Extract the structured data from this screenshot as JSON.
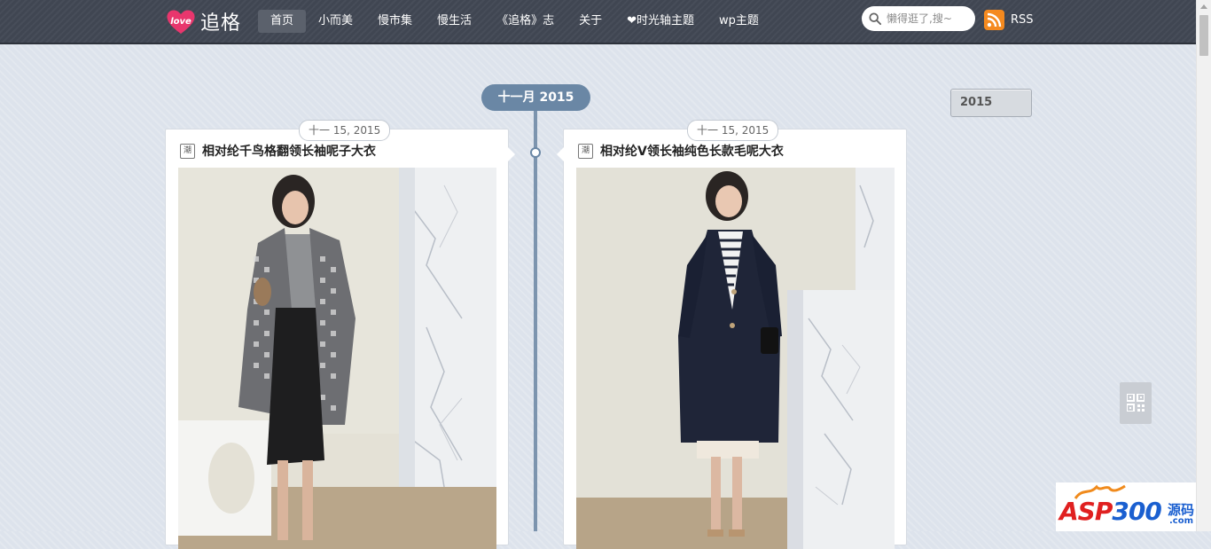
{
  "header": {
    "logo_text": "追格",
    "logo_mark": "love",
    "nav": [
      {
        "label": "首页",
        "active": true
      },
      {
        "label": "小而美",
        "active": false
      },
      {
        "label": "慢市集",
        "active": false
      },
      {
        "label": "慢生活",
        "active": false
      },
      {
        "label": "《追格》志",
        "active": false
      },
      {
        "label": "关于",
        "active": false
      },
      {
        "label": "❤时光轴主题",
        "active": false
      },
      {
        "label": "wp主题",
        "active": false
      }
    ],
    "search_placeholder": "懒得逛了,搜~",
    "rss_label": "RSS"
  },
  "timeline": {
    "month_label": "十一月 2015",
    "year_label": "2015",
    "posts": [
      {
        "date": "十一 15, 2015",
        "tag": "潮",
        "title": "相对纶千鸟格翻领长袖呢子大衣"
      },
      {
        "date": "十一 15, 2015",
        "tag": "潮",
        "title": "相对纶V领长袖纯色长款毛呢大衣"
      }
    ]
  },
  "watermark": {
    "brand": "ASP",
    "number": "300",
    "cn": "源码",
    "domain": ".com"
  },
  "colors": {
    "topbar": "#404652",
    "accent": "#6a87a5",
    "rss": "#f58a1f",
    "logo": "#e8366d"
  }
}
